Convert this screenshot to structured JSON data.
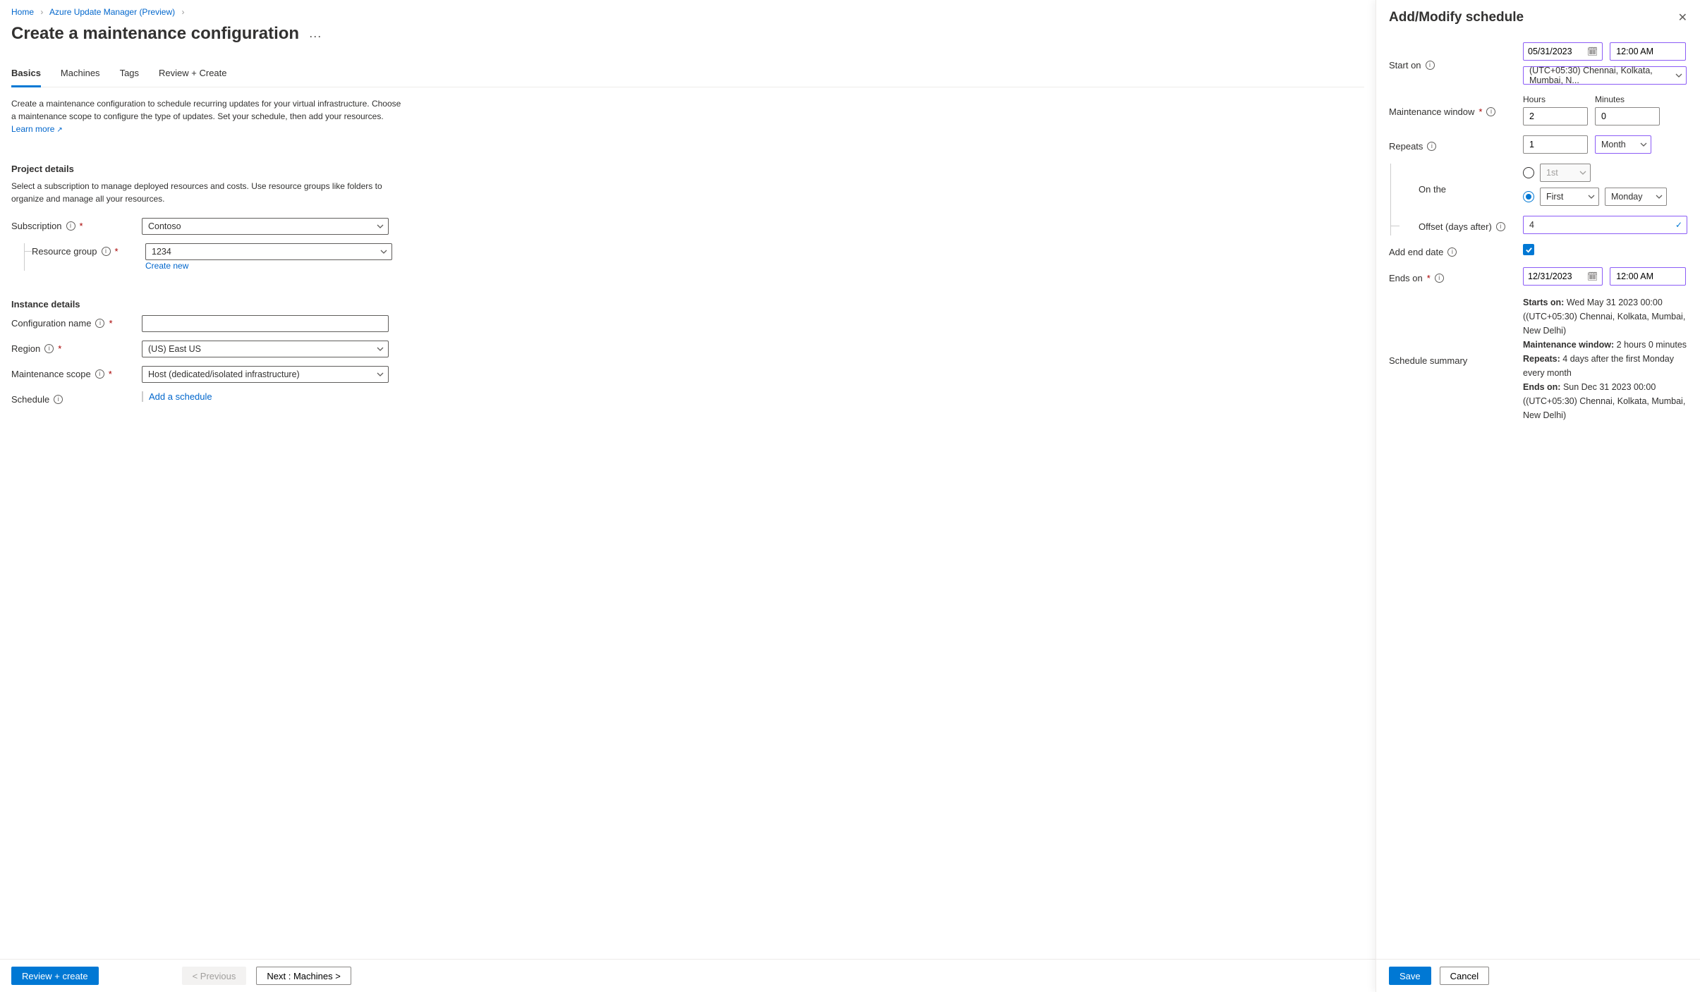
{
  "breadcrumbs": {
    "home": "Home",
    "parent": "Azure Update Manager (Preview)"
  },
  "page": {
    "title": "Create a maintenance configuration"
  },
  "tabs": [
    "Basics",
    "Machines",
    "Tags",
    "Review + Create"
  ],
  "intro": {
    "text": "Create a maintenance configuration to schedule recurring updates for your virtual infrastructure. Choose a maintenance scope to configure the type of updates. Set your schedule, then add your resources.",
    "learn_more": "Learn more"
  },
  "sections": {
    "project": {
      "title": "Project details",
      "desc": "Select a subscription to manage deployed resources and costs. Use resource groups like folders to organize and manage all your resources.",
      "subscription_label": "Subscription",
      "subscription_value": "Contoso",
      "rg_label": "Resource group",
      "rg_value": "1234",
      "create_new": "Create new"
    },
    "instance": {
      "title": "Instance details",
      "config_name_label": "Configuration name",
      "config_name_value": "",
      "region_label": "Region",
      "region_value": "(US) East US",
      "scope_label": "Maintenance scope",
      "scope_value": "Host (dedicated/isolated infrastructure)",
      "schedule_label": "Schedule",
      "add_schedule": "Add a schedule"
    }
  },
  "footer": {
    "review": "Review + create",
    "previous": "< Previous",
    "next": "Next : Machines >"
  },
  "panel": {
    "title": "Add/Modify schedule",
    "start_on_label": "Start on",
    "start_date": "05/31/2023",
    "start_time": "12:00 AM",
    "timezone": "(UTC+05:30) Chennai, Kolkata, Mumbai, N...",
    "mw_label": "Maintenance window",
    "hours_label": "Hours",
    "hours_value": "2",
    "minutes_label": "Minutes",
    "minutes_value": "0",
    "repeats_label": "Repeats",
    "repeat_n": "1",
    "repeat_unit": "Month",
    "on_the_label": "On the",
    "ordinal_disabled": "1st",
    "ordinal": "First",
    "weekday": "Monday",
    "offset_label": "Offset (days after)",
    "offset_value": "4",
    "add_end_label": "Add end date",
    "ends_on_label": "Ends on",
    "end_date": "12/31/2023",
    "end_time": "12:00 AM",
    "summary_label": "Schedule summary",
    "summary": {
      "starts_on_k": "Starts on:",
      "starts_on_v": " Wed May 31 2023 00:00 ((UTC+05:30) Chennai, Kolkata, Mumbai, New Delhi)",
      "mw_k": "Maintenance window:",
      "mw_v": " 2 hours 0 minutes",
      "repeats_k": "Repeats:",
      "repeats_v": " 4 days after the first Monday every month",
      "ends_on_k": "Ends on:",
      "ends_on_v": " Sun Dec 31 2023 00:00 ((UTC+05:30) Chennai, Kolkata, Mumbai, New Delhi)"
    },
    "save": "Save",
    "cancel": "Cancel"
  }
}
